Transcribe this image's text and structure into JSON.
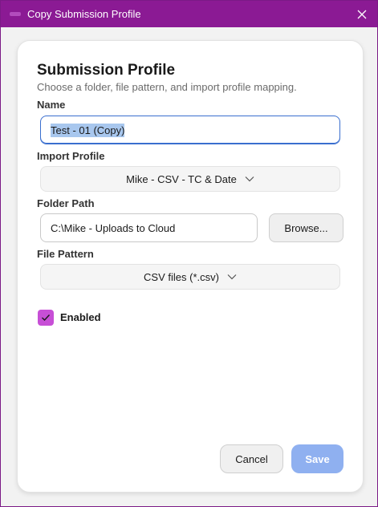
{
  "window": {
    "title": "Copy Submission Profile",
    "accent_color": "#8b1a94"
  },
  "form": {
    "heading": "Submission Profile",
    "subtitle": "Choose a folder, file pattern, and import profile mapping.",
    "name": {
      "label": "Name",
      "value": "Test - 01 (Copy)"
    },
    "import_profile": {
      "label": "Import Profile",
      "selected": "Mike - CSV - TC & Date"
    },
    "folder_path": {
      "label": "Folder Path",
      "value": "C:\\Mike - Uploads to Cloud",
      "browse_label": "Browse..."
    },
    "file_pattern": {
      "label": "File Pattern",
      "selected": "CSV files (*.csv)"
    },
    "enabled": {
      "label": "Enabled",
      "checked": true,
      "color": "#c74fd6"
    }
  },
  "actions": {
    "cancel_label": "Cancel",
    "save_label": "Save",
    "save_color": "#8fb0f0"
  }
}
